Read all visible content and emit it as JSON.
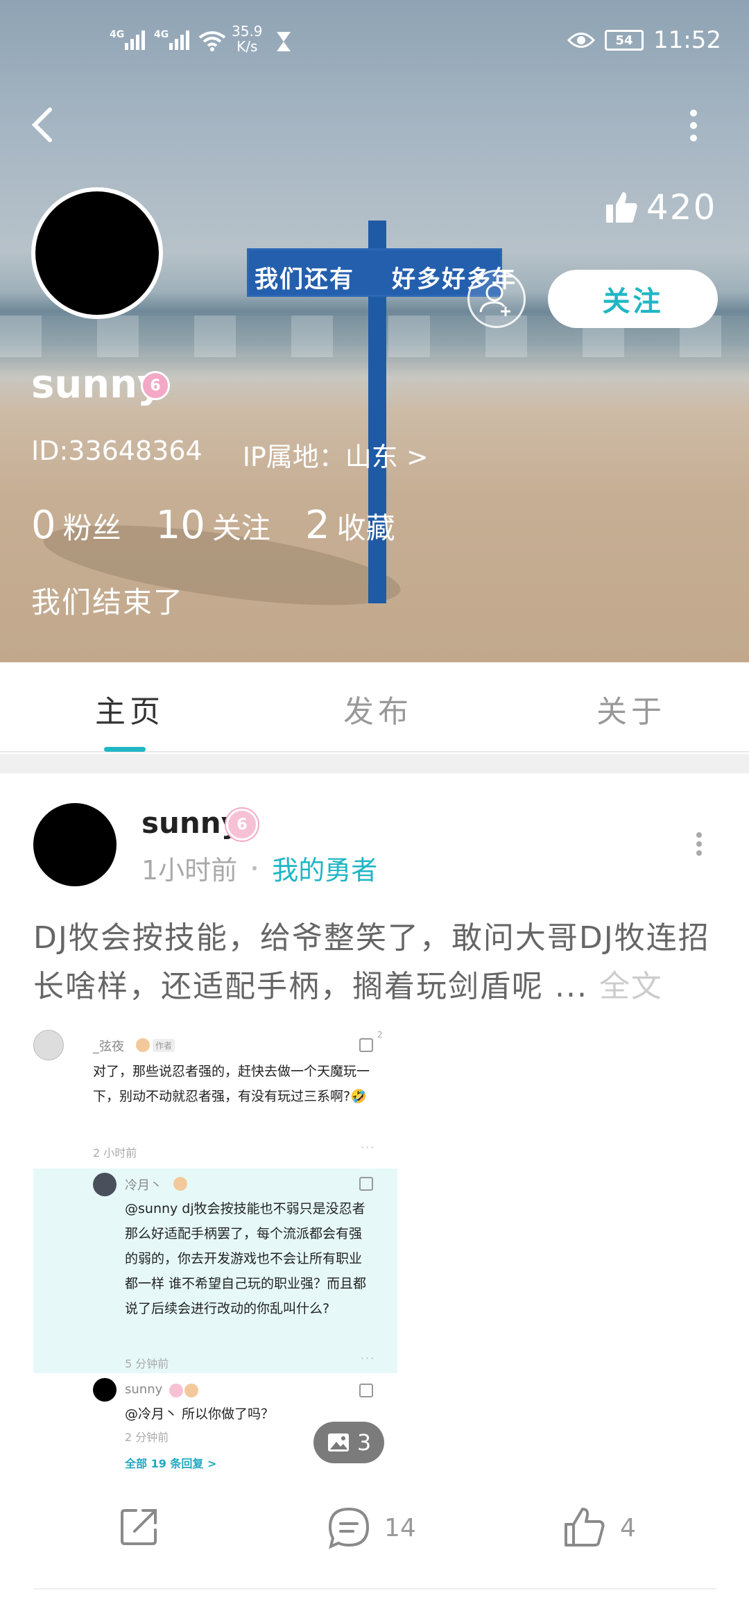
{
  "status_bar": {
    "network1": "4G",
    "network2": "4G",
    "speed_value": "35.9",
    "speed_unit": "K/s",
    "battery": "54",
    "time": "11:52"
  },
  "profile": {
    "likes": "420",
    "follow_label": "关注",
    "username": "sunny",
    "level_badge": "6",
    "id_text": "ID:33648364",
    "ip_text": "IP属地：山东 >",
    "stats": [
      {
        "num": "0",
        "label": "粉丝"
      },
      {
        "num": "10",
        "label": "关注"
      },
      {
        "num": "2",
        "label": "收藏"
      }
    ],
    "signature": "我们结束了"
  },
  "background_sign": {
    "left_text": "我们还有",
    "right_text": "好多好多年"
  },
  "tabs": [
    {
      "label": "主页",
      "active": true
    },
    {
      "label": "发布",
      "active": false
    },
    {
      "label": "关于",
      "active": false
    }
  ],
  "post": {
    "author": "sunny",
    "badge": "6",
    "time": "1小时前",
    "topic": "我的勇者",
    "text": "DJ牧会按技能，给爷整笑了，敢问大哥DJ牧连招长啥样，还适配手柄，搁着玩剑盾呢",
    "ellipsis": " ... ",
    "full_label": "全文",
    "image_count": "3",
    "comment_count": "14",
    "like_count": "4"
  },
  "embedded_comments": {
    "c1": {
      "name": "_弦夜",
      "tag": "作者",
      "like": "2",
      "text": "对了，那些说忍者强的，赶快去做一个天魔玩一下，别动不动就忍者强，有没有玩过三系啊?🤣",
      "time": "2 小时前"
    },
    "c2": {
      "name": "冷月丶",
      "text": "@sunny  dj牧会按技能也不弱只是没忍者那么好适配手柄罢了，每个流派都会有强的弱的，你去开发游戏也不会让所有职业都一样 谁不希望自己玩的职业强？而且都说了后续会进行改动的你乱叫什么?",
      "time": "5 分钟前"
    },
    "c3": {
      "name": "sunny",
      "text": "@冷月丶  所以你做了吗？",
      "time": "2 分钟前"
    },
    "all_replies": "全部 19 条回复 >"
  },
  "colors": {
    "accent": "#20b6c4",
    "badge_pink": "#f3a8c5"
  }
}
